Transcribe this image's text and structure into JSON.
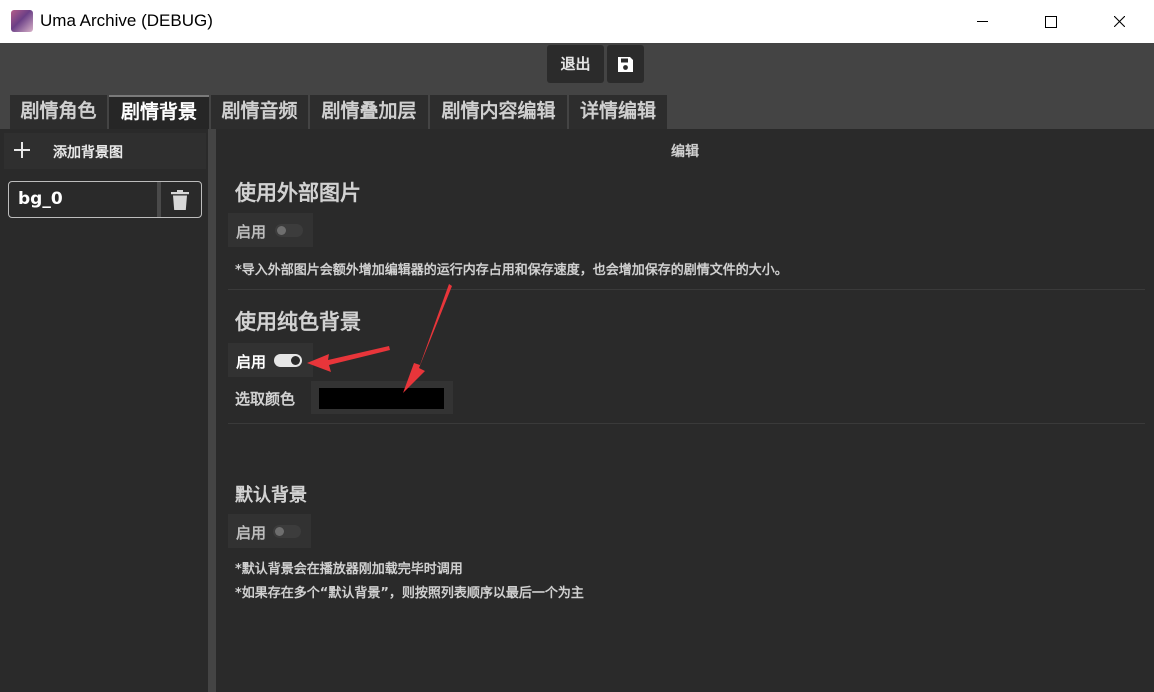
{
  "window": {
    "title": "Uma Archive (DEBUG)"
  },
  "toolbar": {
    "exit_label": "退出",
    "save_icon": "floppy-disk-icon"
  },
  "tabs": [
    {
      "label": "剧情角色",
      "active": false
    },
    {
      "label": "剧情背景",
      "active": true
    },
    {
      "label": "剧情音频",
      "active": false
    },
    {
      "label": "剧情叠加层",
      "active": false
    },
    {
      "label": "剧情内容编辑",
      "active": false
    },
    {
      "label": "详情编辑",
      "active": false
    }
  ],
  "sidebar": {
    "add_label": "添加背景图",
    "items": [
      {
        "name": "bg_0"
      }
    ]
  },
  "main": {
    "header": "编辑",
    "external_image": {
      "title": "使用外部图片",
      "toggle_label": "启用",
      "enabled": false,
      "note": "*导入外部图片会额外增加编辑器的运行内存占用和保存速度，也会增加保存的剧情文件的大小。"
    },
    "solid_color": {
      "title": "使用纯色背景",
      "toggle_label": "启用",
      "enabled": true,
      "color_label": "选取颜色",
      "color_value": "#000000"
    },
    "default_bg": {
      "title": "默认背景",
      "toggle_label": "启用",
      "enabled": false,
      "note1": "*默认背景会在播放器刚加载完毕时调用",
      "note2": "*如果存在多个“默认背景”，则按照列表顺序以最后一个为主"
    }
  },
  "colors": {
    "accent_arrow": "#e8353a",
    "panel": "#2a2a2a",
    "app_bg": "#444444"
  }
}
